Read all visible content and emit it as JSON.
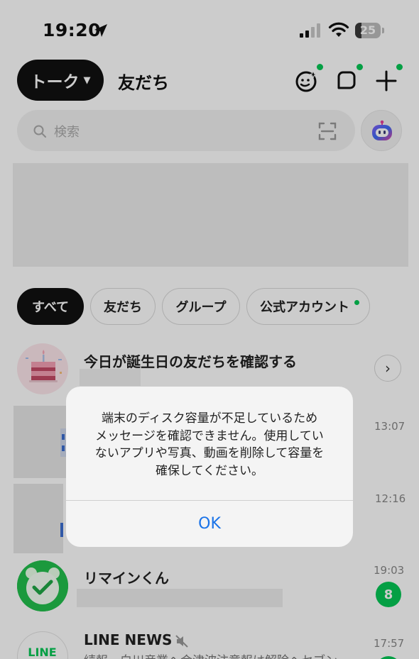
{
  "status_bar": {
    "time": "19:20",
    "battery": "25",
    "battery_level": 0.25,
    "icons": [
      "location-arrow-icon",
      "signal-icon",
      "wifi-icon",
      "battery-icon"
    ]
  },
  "header": {
    "tab_talk": "トーク",
    "tab_friends": "友だち",
    "icons": [
      "sparkle-face-icon",
      "square-icon",
      "plus-icon"
    ]
  },
  "search": {
    "placeholder": "検索"
  },
  "filters": [
    "すべて",
    "友だち",
    "グループ",
    "公式アカウント"
  ],
  "birthday": {
    "title": "今日が誕生日の友だちを確認する"
  },
  "chats": [
    {
      "time": "13:07"
    },
    {
      "time": "12:16"
    },
    {
      "name": "リマインくん",
      "time": "19:03",
      "badge": "8"
    },
    {
      "name": "LINE NEWS",
      "time": "17:57",
      "avatar_text": "LINE",
      "preview": "続報　白川産業へ会津波注意報は解除ヘセブン"
    }
  ],
  "alert": {
    "message": "端末のディスク容量が不足しているため\nメッセージを確認できません。使用してい\nないアプリや写真、動画を削除して容量を\n確保してください。",
    "ok": "OK"
  },
  "colors": {
    "line_green": "#06c755",
    "ios_blue": "#1a73e8"
  }
}
